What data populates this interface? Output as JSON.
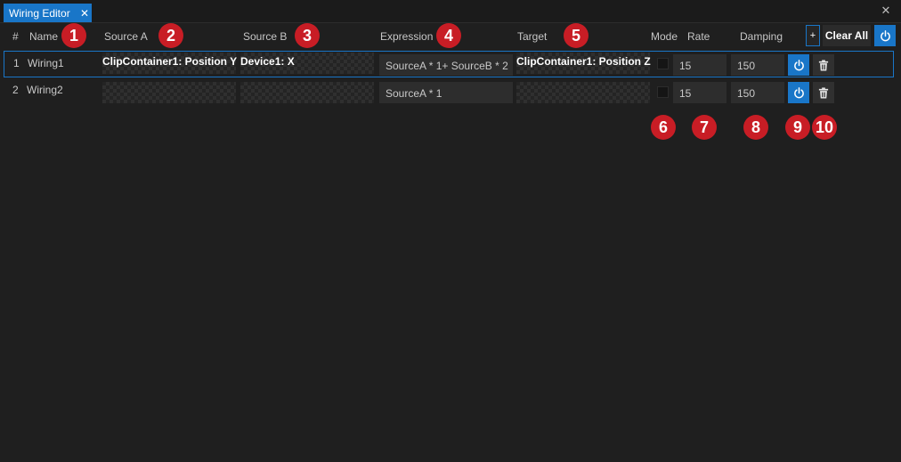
{
  "tab": {
    "title": "Wiring Editor",
    "close_glyph": "✕"
  },
  "window_close_glyph": "✕",
  "columns": {
    "num": "#",
    "name": "Name",
    "source_a": "Source A",
    "source_b": "Source B",
    "expression": "Expression",
    "target": "Target",
    "mode": "Mode",
    "rate": "Rate",
    "damping": "Damping"
  },
  "toolbar": {
    "add_label": "+",
    "clear_all_label": "Clear All"
  },
  "rows": [
    {
      "num": "1",
      "name": "Wiring1",
      "source_a": "ClipContainer1: Position Y",
      "source_b": "Device1: X",
      "expression": "SourceA * 1+ SourceB * 2",
      "target": "ClipContainer1: Position Z",
      "mode_checked": false,
      "rate": "15",
      "damping": "150",
      "selected": true
    },
    {
      "num": "2",
      "name": "Wiring2",
      "source_a": "",
      "source_b": "",
      "expression": "SourceA * 1",
      "target": "",
      "mode_checked": false,
      "rate": "15",
      "damping": "150",
      "selected": false
    }
  ],
  "callouts": [
    "1",
    "2",
    "3",
    "4",
    "5",
    "6",
    "7",
    "8",
    "9",
    "10"
  ],
  "colors": {
    "accent": "#1976c8",
    "callout": "#c81d25",
    "background": "#1f1f1f"
  },
  "icons": {
    "power": "power-icon",
    "delete": "trash-icon",
    "close": "close-icon"
  }
}
